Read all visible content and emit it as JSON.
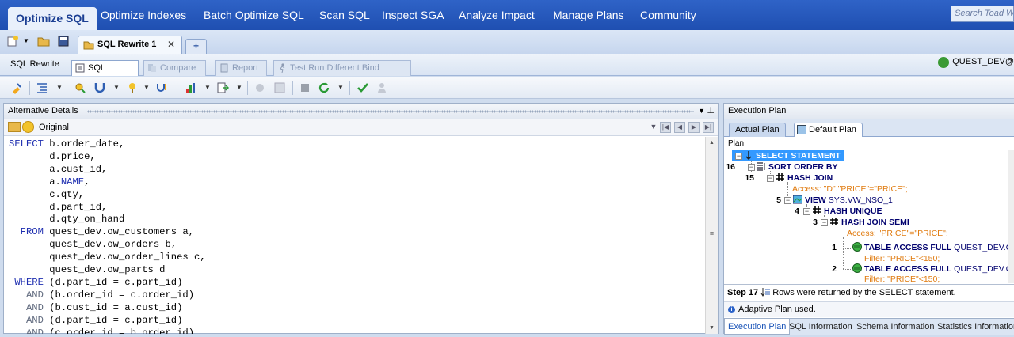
{
  "menu": {
    "tabs": [
      "Optimize SQL",
      "Optimize Indexes",
      "Batch Optimize SQL",
      "Scan SQL",
      "Inspect SGA",
      "Analyze Impact",
      "Manage Plans",
      "Community"
    ],
    "search_placeholder": "Search Toad World"
  },
  "document": {
    "tab_title": "SQL Rewrite 1",
    "close_glyph": "✕",
    "new_tab_glyph": "+"
  },
  "subtabs": {
    "sql_rewrite": "SQL Rewrite",
    "sql_details": "SQL Details",
    "compare": "Compare",
    "report": "Report",
    "test_run": "Test Run Different Bind Values"
  },
  "user": "QUEST_DEV@",
  "left_panel": {
    "title": "Alternative Details",
    "selection": "Original",
    "sql_lines": [
      {
        "kw": "SELECT",
        "rest": " b.order_date,"
      },
      {
        "kw": "",
        "rest": "       d.price,"
      },
      {
        "kw": "",
        "rest": "       a.cust_id,"
      },
      {
        "kw": "",
        "rest": "       a.",
        "ident": "NAME",
        "after": ","
      },
      {
        "kw": "",
        "rest": "       c.qty,"
      },
      {
        "kw": "",
        "rest": "       d.part_id,"
      },
      {
        "kw": "",
        "rest": "       d.qty_on_hand"
      },
      {
        "kw": "  FROM",
        "rest": " quest_dev.ow_customers a,"
      },
      {
        "kw": "",
        "rest": "       quest_dev.ow_orders b,"
      },
      {
        "kw": "",
        "rest": "       quest_dev.ow_order_lines c,"
      },
      {
        "kw": "",
        "rest": "       quest_dev.ow_parts d"
      },
      {
        "kw": " WHERE",
        "rest": " (d.part_id = c.part_id)"
      },
      {
        "kw2": "   AND",
        "rest": " (b.order_id = c.order_id)"
      },
      {
        "kw2": "   AND",
        "rest": " (b.cust_id = a.cust_id)"
      },
      {
        "kw2": "   AND",
        "rest": " (d.part_id = c.part_id)"
      },
      {
        "kw2": "   AND",
        "rest": " (c.order_id = b.order_id)"
      }
    ]
  },
  "right_panel": {
    "title": "Execution Plan",
    "tab_actual": "Actual Plan",
    "tab_default": "Default Plan",
    "plan_label": "Plan",
    "rows": [
      {
        "num": "",
        "op": "SELECT STATEMENT",
        "obj": "",
        "pred": ""
      },
      {
        "num": "16",
        "op": "SORT ORDER BY",
        "obj": "",
        "pred": ""
      },
      {
        "num": "15",
        "op": "HASH JOIN",
        "obj": "",
        "pred": "Access: \"D\".\"PRICE\"=\"PRICE\";"
      },
      {
        "num": "5",
        "op": "VIEW",
        "obj": "SYS.VW_NSO_1",
        "pred": ""
      },
      {
        "num": "4",
        "op": "HASH UNIQUE",
        "obj": "",
        "pred": ""
      },
      {
        "num": "3",
        "op": "HASH JOIN SEMI",
        "obj": "",
        "pred": "Access: \"PRICE\"=\"PRICE\";"
      },
      {
        "num": "1",
        "op": "TABLE ACCESS FULL",
        "obj": "QUEST_DEV.OW_PARTS",
        "pred": "Filter: \"PRICE\"<150;"
      },
      {
        "num": "2",
        "op": "TABLE ACCESS FULL",
        "obj": "QUEST_DEV.OW_PARTS",
        "pred": "Filter: \"PRICE\"<150;"
      }
    ],
    "step_label": "Step 17",
    "step_text": "Rows were returned by the SELECT statement.",
    "adaptive": "Adaptive Plan used.",
    "bottom_tabs": [
      "Execution Plan",
      "SQL Information",
      "Schema Information",
      "Statistics Information"
    ]
  }
}
